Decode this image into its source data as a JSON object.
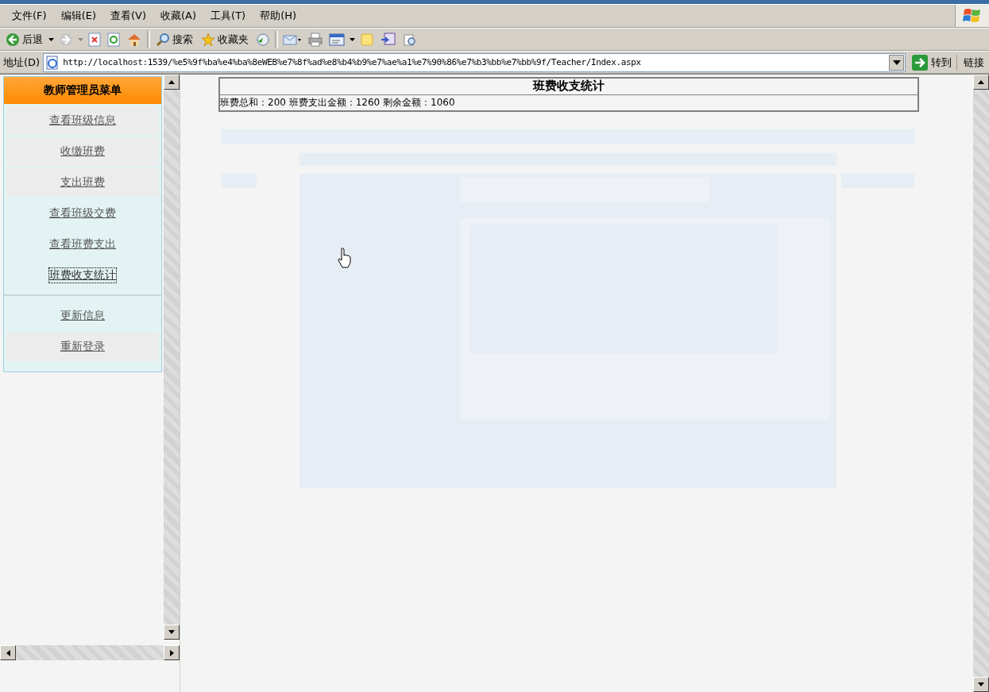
{
  "menu_bar": {
    "items": [
      "文件(F)",
      "编辑(E)",
      "查看(V)",
      "收藏(A)",
      "工具(T)",
      "帮助(H)"
    ]
  },
  "toolbar": {
    "back": "后退",
    "search": "搜索",
    "favorites": "收藏夹"
  },
  "address_bar": {
    "label": "地址(D)",
    "url": "http://localhost:1539/%e5%9f%ba%e4%ba%8eWEB%e7%8f%ad%e8%b4%b9%e7%ae%a1%e7%90%86%e7%b3%bb%e7%bb%9f/Teacher/Index.aspx",
    "go": "转到",
    "links": "链接"
  },
  "sidebar": {
    "title": "教师管理员菜单",
    "groups": [
      {
        "items": [
          {
            "label": "查看班级信息",
            "selected": false,
            "color": "#ececec"
          },
          {
            "label": "收缴班费",
            "selected": false,
            "color": "#ececec"
          },
          {
            "label": "支出班费",
            "selected": false,
            "color": "#ececec"
          },
          {
            "label": "查看班级交费",
            "selected": false,
            "color": "#e3f3f3"
          },
          {
            "label": "查看班费支出",
            "selected": false,
            "color": "#e3f3f3"
          },
          {
            "label": "班费收支统计",
            "selected": true,
            "color": "#e3f3f3"
          }
        ]
      },
      {
        "items": [
          {
            "label": "更新信息",
            "selected": false,
            "color": "#e3f3f3"
          },
          {
            "label": "重新登录",
            "selected": false,
            "color": "#ececec"
          }
        ]
      }
    ]
  },
  "report": {
    "title": "班费收支统计",
    "summary": "班费总和：200 班费支出金额：1260 剩余金额：1060"
  }
}
